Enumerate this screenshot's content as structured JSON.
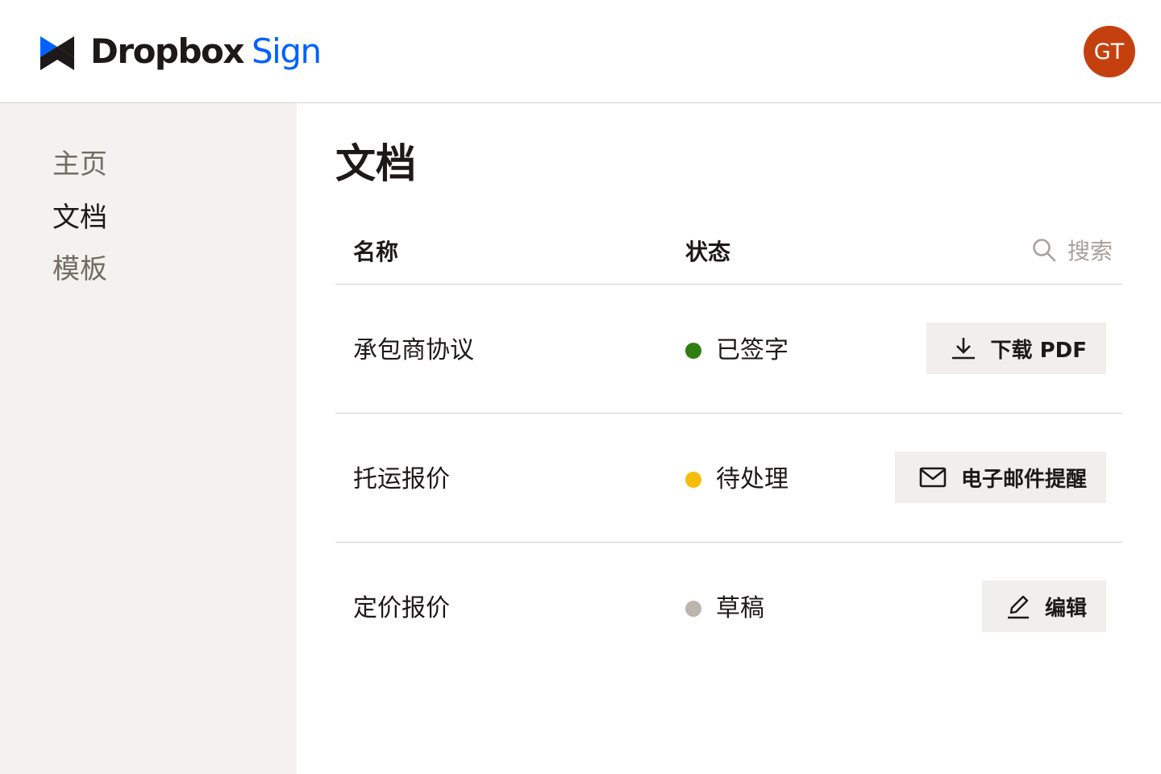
{
  "header": {
    "brand_primary": "Dropbox",
    "brand_secondary": "Sign",
    "avatar_initials": "GT",
    "avatar_color": "#c4410f",
    "brand_color": "#0061fe"
  },
  "sidebar": {
    "items": [
      {
        "label": "主页",
        "active": false
      },
      {
        "label": "文档",
        "active": true
      },
      {
        "label": "模板",
        "active": false
      }
    ]
  },
  "main": {
    "title": "文档",
    "columns": {
      "name": "名称",
      "status": "状态"
    },
    "search": {
      "label": "搜索",
      "icon": "search-icon"
    },
    "rows": [
      {
        "name": "承包商协议",
        "status": "已签字",
        "status_color": "#2e7d13",
        "action": "下载 PDF",
        "action_icon": "download-icon"
      },
      {
        "name": "托运报价",
        "status": "待处理",
        "status_color": "#f5bd0a",
        "action": "电子邮件提醒",
        "action_icon": "mail-icon"
      },
      {
        "name": "定价报价",
        "status": "草稿",
        "status_color": "#bbb5ae",
        "action": "编辑",
        "action_icon": "pencil-icon"
      }
    ]
  }
}
